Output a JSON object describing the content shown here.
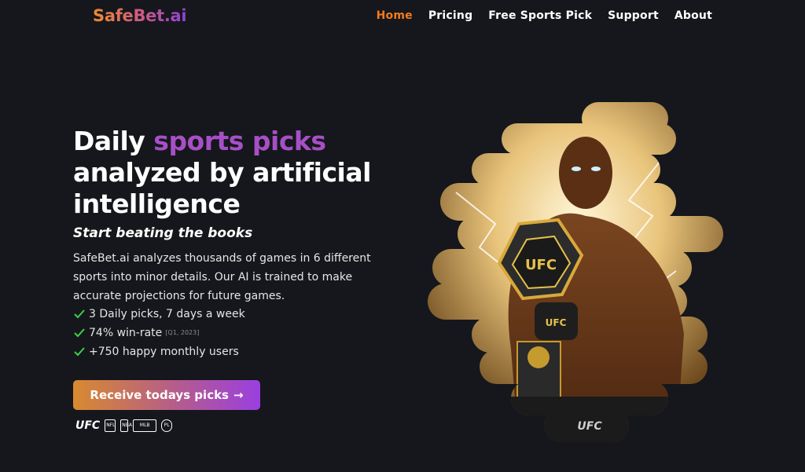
{
  "nav": {
    "logo": "SafeBet.ai",
    "items": [
      {
        "label": "Home",
        "active": true
      },
      {
        "label": "Pricing",
        "active": false
      },
      {
        "label": "Free Sports Pick",
        "active": false
      },
      {
        "label": "Support",
        "active": false
      },
      {
        "label": "About",
        "active": false
      }
    ]
  },
  "hero": {
    "title_part1": "Daily ",
    "title_highlight": "sports picks",
    "title_part2": "analyzed by artificial intelligence",
    "tagline": "Start beating the books",
    "description": "SafeBet.ai analyzes thousands of games in 6 different sports into minor details. Our AI is trained to make accurate projections for future games.",
    "features": [
      {
        "text": "3 Daily picks, 7 days a week",
        "note": ""
      },
      {
        "text": "74% win-rate",
        "note": "[Q1, 2023]"
      },
      {
        "text": "+750 happy monthly users",
        "note": ""
      }
    ],
    "cta_label": "Receive todays picks",
    "cta_arrow": "→",
    "leagues": {
      "ufc": "UFC",
      "nfl": "NFL",
      "nba": "NBA",
      "mlb": "MLB",
      "epl": "PL"
    },
    "art_text": {
      "belt": "UFC",
      "glove": "UFC",
      "shorts": "UFC"
    }
  },
  "colors": {
    "background": "#15171c",
    "accent_orange": "#f47a1f",
    "accent_purple": "#9a3fe0",
    "check_green": "#3ecf4a"
  }
}
